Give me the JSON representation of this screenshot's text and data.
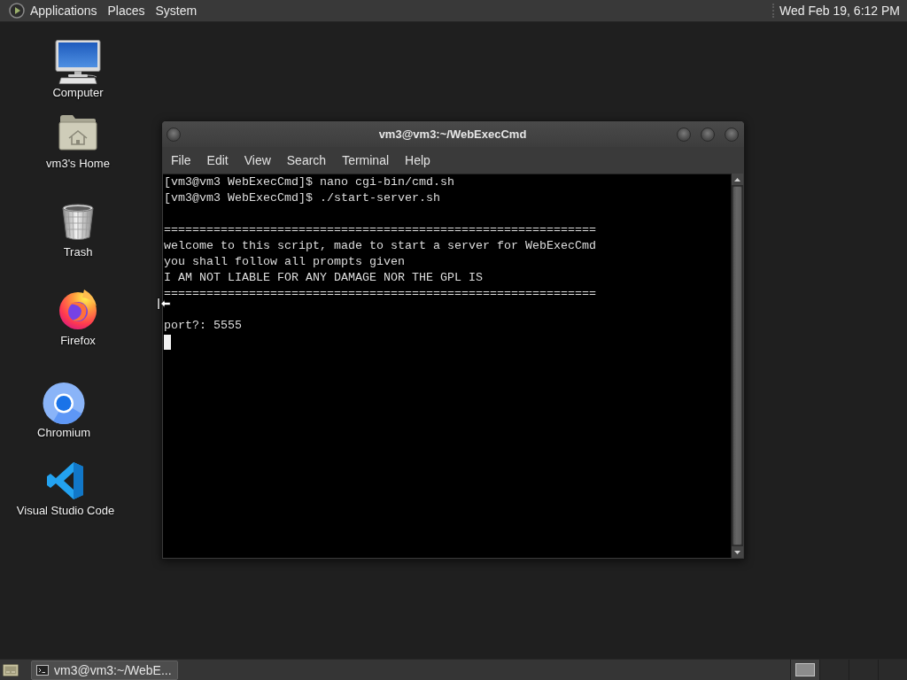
{
  "top_panel": {
    "menus": [
      "Applications",
      "Places",
      "System"
    ],
    "clock": "Wed Feb 19, 6:12 PM"
  },
  "desktop_icons": [
    {
      "kind": "computer",
      "label": "Computer"
    },
    {
      "kind": "home",
      "label": "vm3's Home"
    },
    {
      "kind": "trash",
      "label": "Trash"
    },
    {
      "kind": "firefox",
      "label": "Firefox"
    },
    {
      "kind": "chromium",
      "label": "Chromium"
    },
    {
      "kind": "vscode",
      "label": "Visual Studio Code"
    }
  ],
  "terminal_window": {
    "title": "vm3@vm3:~/WebExecCmd",
    "menu": [
      "File",
      "Edit",
      "View",
      "Search",
      "Terminal",
      "Help"
    ],
    "output_blocks": [
      [
        "[vm3@vm3 WebExecCmd]$ nano cgi-bin/cmd.sh",
        "[vm3@vm3 WebExecCmd]$ ./start-server.sh"
      ],
      [
        "=============================================================",
        "welcome to this script, made to start a server for WebExecCmd",
        "you shall follow all prompts given",
        "I AM NOT LIABLE FOR ANY DAMAGE NOR THE GPL IS",
        "============================================================="
      ],
      [
        "port?: 5555"
      ]
    ]
  },
  "bottom_panel": {
    "tasks": [
      {
        "label": "vm3@vm3:~/WebE...",
        "selected": true
      }
    ],
    "workspaces": [
      {
        "selected": true
      },
      {
        "selected": false
      },
      {
        "selected": false
      },
      {
        "selected": false
      }
    ]
  }
}
